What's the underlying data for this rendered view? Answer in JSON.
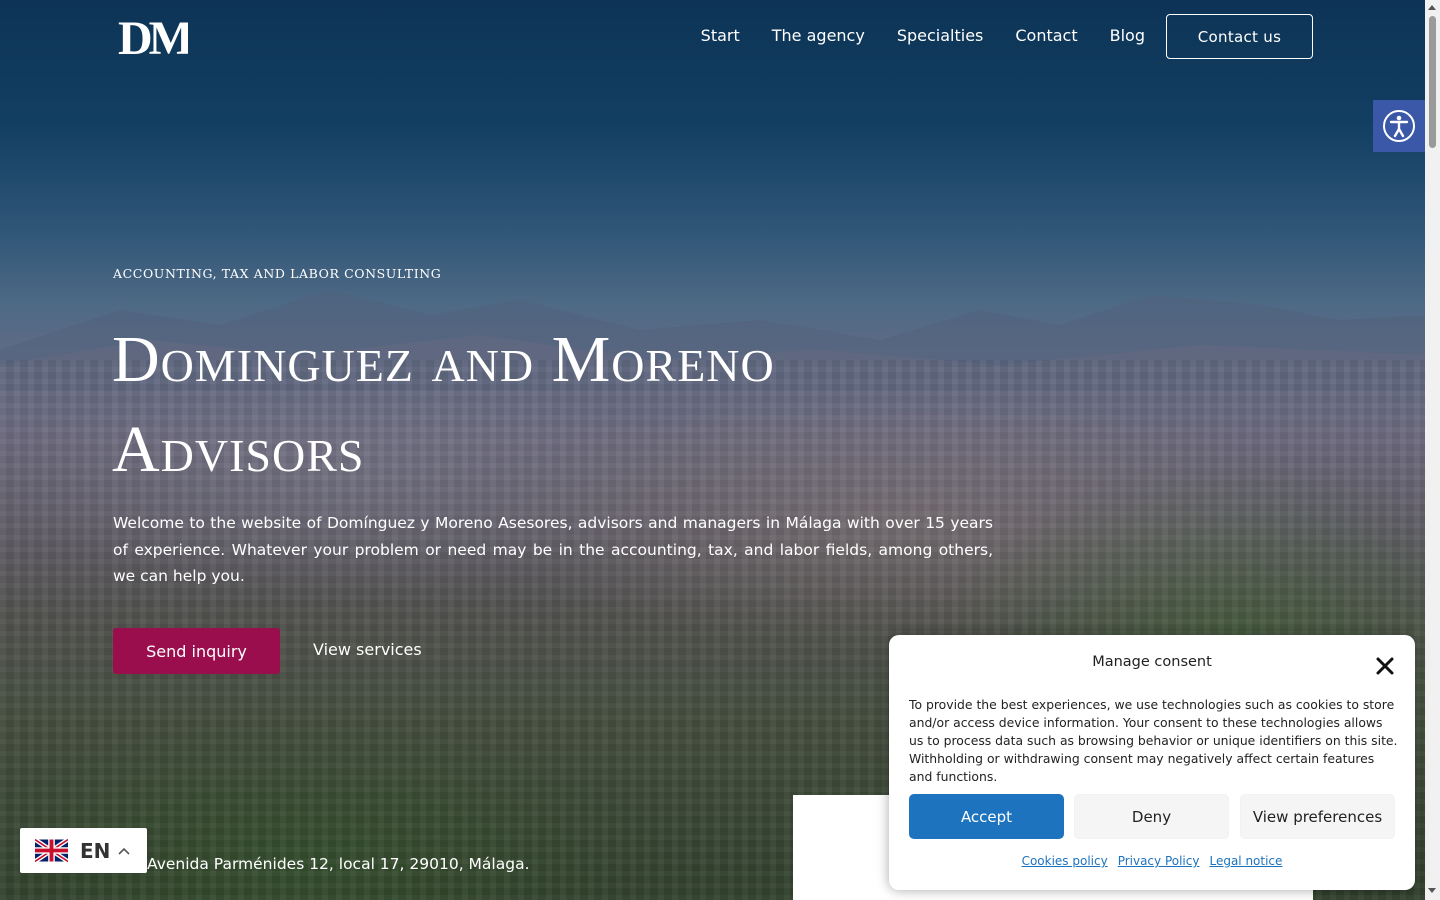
{
  "header": {
    "logo_text": "DM",
    "nav": [
      {
        "label": "Start"
      },
      {
        "label": "The agency"
      },
      {
        "label": "Specialties"
      },
      {
        "label": "Contact"
      },
      {
        "label": "Blog"
      }
    ],
    "contact_button": "Contact us"
  },
  "hero": {
    "eyebrow": "Accounting, tax and labor consulting",
    "headline": "Dominguez and Moreno Advisors",
    "intro": "Welcome to the website of Domínguez y Moreno Asesores, advisors and managers in Málaga with over 15 years of experience. Whatever your problem or need may be in the accounting, tax, and labor fields, among others, we can help you.",
    "primary_button": "Send inquiry",
    "secondary_link": "View services",
    "address": "Avenida Parménides 12, local 17, 29010, Málaga."
  },
  "language": {
    "code": "EN",
    "flag_icon": "uk-flag-icon"
  },
  "accessibility": {
    "icon": "accessibility-icon"
  },
  "consent": {
    "title": "Manage consent",
    "text": "To provide the best experiences, we use technologies such as cookies to store and/or access device information. Your consent to these technologies allows us to process data such as browsing behavior or unique identifiers on this site. Withholding or withdrawing consent may negatively affect certain features and functions.",
    "accept": "Accept",
    "deny": "Deny",
    "preferences": "View preferences",
    "links": [
      {
        "label": "Cookies policy"
      },
      {
        "label": "Privacy Policy"
      },
      {
        "label": "Legal notice"
      }
    ]
  },
  "colors": {
    "brand": "#9b0e4e",
    "accept": "#1e73be",
    "accessibility": "#3a57a8",
    "header_bg": "#0e3a5e"
  }
}
